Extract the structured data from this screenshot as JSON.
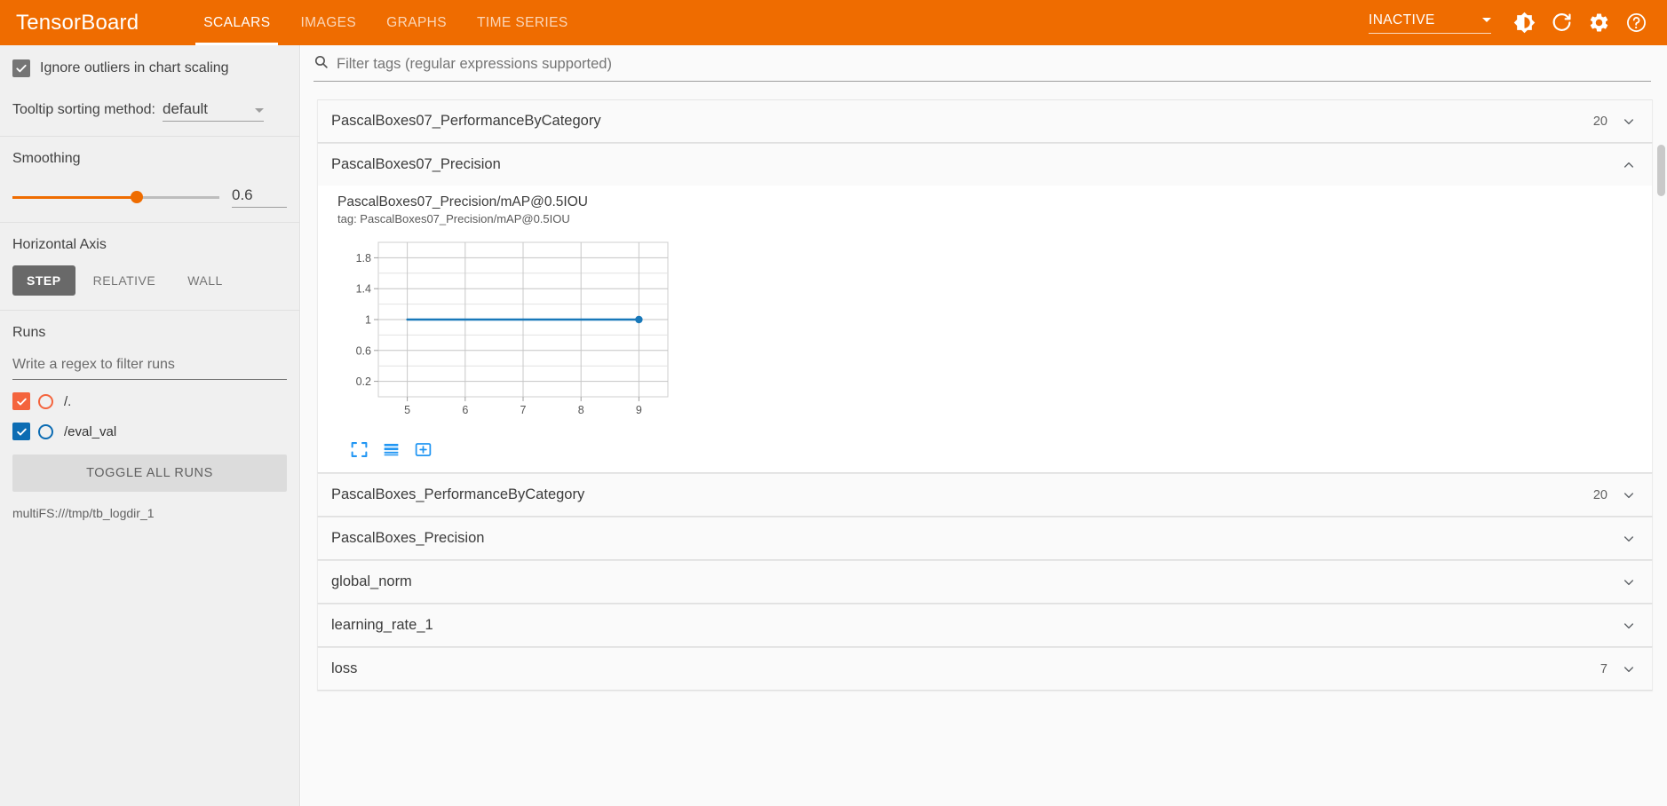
{
  "header": {
    "brand": "TensorBoard",
    "tabs": [
      {
        "label": "SCALARS",
        "active": true
      },
      {
        "label": "IMAGES",
        "active": false
      },
      {
        "label": "GRAPHS",
        "active": false
      },
      {
        "label": "TIME SERIES",
        "active": false
      }
    ],
    "status": "INACTIVE",
    "icons": [
      "brightness-icon",
      "refresh-icon",
      "settings-gear-icon",
      "help-icon"
    ]
  },
  "sidebar": {
    "ignore_outliers": {
      "label": "Ignore outliers in chart scaling",
      "checked": true
    },
    "tooltip_sorting": {
      "label": "Tooltip sorting method:",
      "value": "default"
    },
    "smoothing": {
      "label": "Smoothing",
      "value": "0.6",
      "fraction": 0.6
    },
    "horizontal_axis": {
      "label": "Horizontal Axis",
      "options": [
        {
          "label": "STEP",
          "active": true
        },
        {
          "label": "RELATIVE",
          "active": false
        },
        {
          "label": "WALL",
          "active": false
        }
      ]
    },
    "runs": {
      "label": "Runs",
      "filter_placeholder": "Write a regex to filter runs",
      "items": [
        {
          "name": "/.",
          "checked": true,
          "color": "#f4643d"
        },
        {
          "name": "/eval_val",
          "checked": true,
          "color": "#0c6cb3"
        }
      ],
      "toggle_all_label": "TOGGLE ALL RUNS",
      "logdir": "multiFS:///tmp/tb_logdir_1"
    }
  },
  "main": {
    "filter_placeholder": "Filter tags (regular expressions supported)",
    "cards": [
      {
        "title": "PascalBoxes07_PerformanceByCategory",
        "badge": "20",
        "expanded": false
      },
      {
        "title": "PascalBoxes07_Precision",
        "badge": "",
        "expanded": true
      },
      {
        "title": "PascalBoxes_PerformanceByCategory",
        "badge": "20",
        "expanded": false
      },
      {
        "title": "PascalBoxes_Precision",
        "badge": "",
        "expanded": false
      },
      {
        "title": "global_norm",
        "badge": "",
        "expanded": false
      },
      {
        "title": "learning_rate_1",
        "badge": "",
        "expanded": false
      },
      {
        "title": "loss",
        "badge": "7",
        "expanded": false
      }
    ],
    "chart": {
      "title": "PascalBoxes07_Precision/mAP@0.5IOU",
      "tag": "tag: PascalBoxes07_Precision/mAP@0.5IOU",
      "icons": [
        "fullscreen-icon",
        "data-table-icon",
        "fit-domain-icon"
      ]
    }
  },
  "chart_data": {
    "type": "line",
    "title": "PascalBoxes07_Precision/mAP@0.5IOU",
    "xlabel": "",
    "ylabel": "",
    "xlim": [
      4.5,
      9.5
    ],
    "ylim": [
      0,
      2
    ],
    "xticks": [
      5,
      6,
      7,
      8,
      9
    ],
    "yticks": [
      0.2,
      0.6,
      1,
      1.4,
      1.8
    ],
    "grid": true,
    "legend": "none",
    "series": [
      {
        "name": "/eval_val",
        "color": "#1878b9",
        "x": [
          5,
          9
        ],
        "y": [
          1.0,
          1.0
        ],
        "markers": [
          {
            "x": 9,
            "y": 1.0
          }
        ]
      }
    ]
  }
}
